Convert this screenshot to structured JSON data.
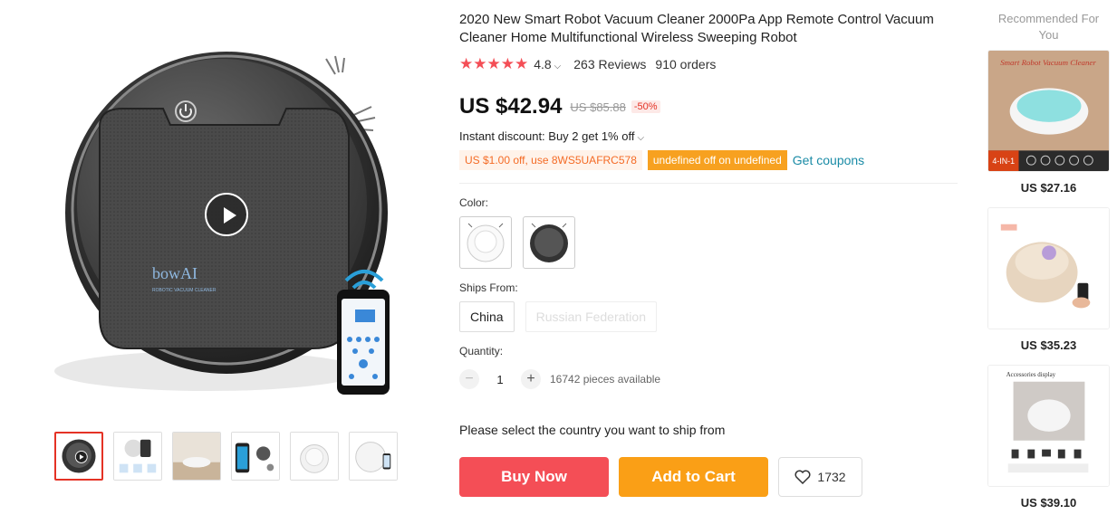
{
  "gallery": {
    "brand_logo": "bowAI",
    "brand_sub": "ROBOTIC VACUUM CLEANER",
    "thumbnails": [
      "thumb-1",
      "thumb-2",
      "thumb-3",
      "thumb-4",
      "thumb-5",
      "thumb-6"
    ],
    "active_thumbnail": 0
  },
  "product": {
    "title": "2020 New Smart Robot Vacuum Cleaner 2000Pa App Remote Control Vacuum Cleaner Home Multifunctional Wireless Sweeping Robot",
    "stars": "★★★★★",
    "rating": "4.8",
    "reviews": "263 Reviews",
    "orders": "910 orders",
    "price": "US $42.94",
    "original_price": "US $85.88",
    "discount": "-50%",
    "instant_discount": "Instant discount: Buy 2 get 1% off",
    "coupon_code_text": "US $1.00 off, use 8WS5UAFRC578",
    "coupon_undefined_text": "undefined off on undefined",
    "get_coupons": "Get coupons",
    "color_label": "Color:",
    "ships_from_label": "Ships From:",
    "ship_options": [
      "China",
      "Russian Federation"
    ],
    "quantity_label": "Quantity:",
    "quantity": "1",
    "pieces_available": "16742 pieces available",
    "ship_message": "Please select the country you want to ship from",
    "buy_now": "Buy Now",
    "add_to_cart": "Add to Cart",
    "wishlist_count": "1732"
  },
  "recommended": {
    "title": "Recommended For You",
    "items": [
      {
        "banner": "Smart Robot Vacuum Cleaner",
        "tag": "4-IN-1",
        "price": "US $27.16"
      },
      {
        "banner": "",
        "tag": "",
        "price": "US $35.23"
      },
      {
        "banner": "Accessories display",
        "tag": "",
        "price": "US $39.10"
      }
    ]
  },
  "colors": {
    "price_red": "#f44e56",
    "buy_now": "#f44e56",
    "add_to_cart": "#fa9f16",
    "coupon_orange": "#f46b25",
    "link_teal": "#1a8ba6"
  }
}
